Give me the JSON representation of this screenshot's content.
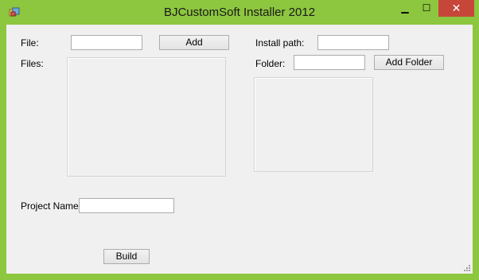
{
  "window": {
    "title": "BJCustomSoft Installer 2012"
  },
  "titlebar": {
    "minimize_glyph": "▁",
    "maximize_glyph": "☐",
    "close_glyph": "✕"
  },
  "icons": {
    "app": "installer-app-icon",
    "minimize": "minimize-icon",
    "maximize": "maximize-icon",
    "close": "close-icon",
    "grip": "resize-grip-icon"
  },
  "form": {
    "file_label": "File:",
    "file_value": "",
    "add_label": "Add",
    "files_label": "Files:",
    "install_path_label": "Install path:",
    "install_path_value": "",
    "folder_label": "Folder:",
    "folder_value": "",
    "add_folder_label": "Add Folder",
    "project_name_label": "Project Name:",
    "project_name_value": "",
    "build_label": "Build"
  },
  "colors": {
    "frame": "#8dc63f",
    "client": "#f0f0f0",
    "close": "#c7463a"
  }
}
